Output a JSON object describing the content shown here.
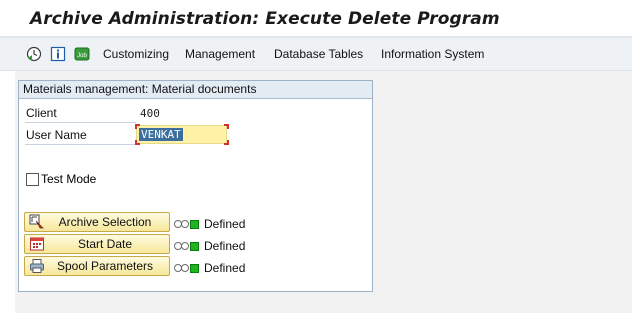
{
  "title": "Archive Administration: Execute Delete Program",
  "toolbar": {
    "icons": [
      "execute-clock-icon",
      "info-icon",
      "job-icon"
    ],
    "job_icon_text": "Job",
    "menu": [
      "Customizing",
      "Management",
      "Database Tables",
      "Information System"
    ]
  },
  "panel": {
    "header": "Materials management: Material documents",
    "client_label": "Client",
    "client_value": "400",
    "user_label": "User Name",
    "user_value": "VENKAT",
    "test_mode_label": "Test Mode",
    "test_mode_checked": false,
    "buttons": [
      {
        "label": "Archive Selection",
        "icon": "selection-icon",
        "status": "Defined"
      },
      {
        "label": "Start Date",
        "icon": "calendar-icon",
        "status": "Defined"
      },
      {
        "label": "Spool Parameters",
        "icon": "printer-icon",
        "status": "Defined"
      }
    ]
  },
  "colors": {
    "input_bg": "#fff1a6",
    "button_bg": "#f6e79a",
    "status_green": "#1fb51f"
  }
}
